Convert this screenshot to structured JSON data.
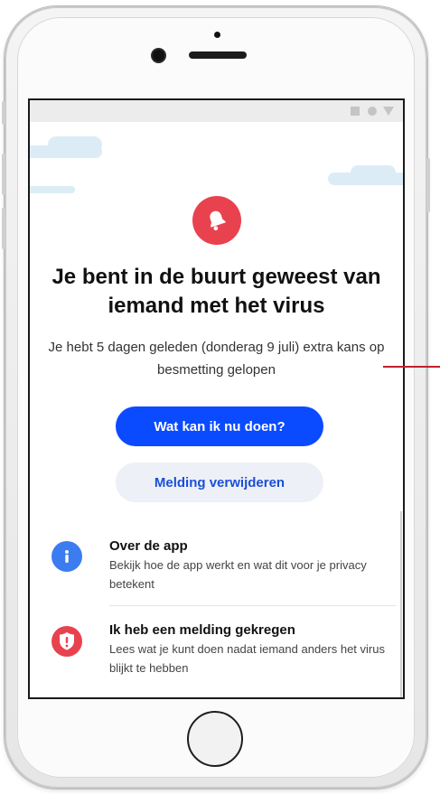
{
  "app": {
    "title": "Je bent in de buurt geweest van iemand met het virus",
    "subtitle": "Je hebt 5 dagen geleden (donderag 9 juli) extra kans op besmetting gelopen"
  },
  "buttons": {
    "primary": "Wat kan ik nu doen?",
    "secondary": "Melding verwijderen"
  },
  "list": [
    {
      "title": "Over de app",
      "desc": "Bekijk hoe de app werkt en wat dit voor je privacy betekent",
      "icon": "info-icon"
    },
    {
      "title": "Ik heb een melding gekregen",
      "desc": "Lees wat je kunt doen nadat iemand anders het virus blijkt te hebben",
      "icon": "alert-icon"
    }
  ],
  "colors": {
    "primary": "#0a4bff",
    "alert": "#e8424f",
    "info": "#3b7cf0",
    "cloud": "#dcecf7",
    "annotation": "#c0202a"
  }
}
